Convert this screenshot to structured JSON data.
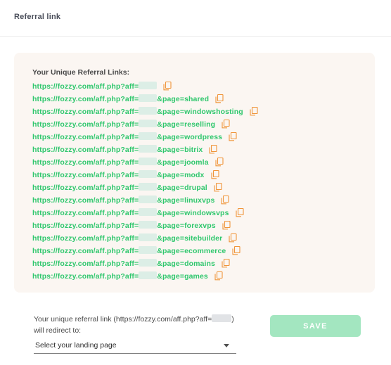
{
  "header": {
    "title": "Referral link"
  },
  "links_section": {
    "heading": "Your Unique Referral Links:",
    "prefix": "https://fozzy.com/aff.php?aff=",
    "links": [
      {
        "suffix": ""
      },
      {
        "suffix": "&page=shared"
      },
      {
        "suffix": "&page=windowshosting"
      },
      {
        "suffix": "&page=reselling"
      },
      {
        "suffix": "&page=wordpress"
      },
      {
        "suffix": "&page=bitrix"
      },
      {
        "suffix": "&page=joomla"
      },
      {
        "suffix": "&page=modx"
      },
      {
        "suffix": "&page=drupal"
      },
      {
        "suffix": "&page=linuxvps"
      },
      {
        "suffix": "&page=windowsvps"
      },
      {
        "suffix": "&page=forexvps"
      },
      {
        "suffix": "&page=sitebuilder"
      },
      {
        "suffix": "&page=ecommerce"
      },
      {
        "suffix": "&page=domains"
      },
      {
        "suffix": "&page=games"
      }
    ],
    "copy_icon": "copy-icon",
    "link_color": "#2fc76d",
    "icon_color": "#f0953a"
  },
  "redirect": {
    "text_before": "Your unique referral link (https://fozzy.com/aff.php?aff=",
    "text_after": ") will redirect to:",
    "select_value": "Select your landing page"
  },
  "save_button": {
    "label": "SAVE",
    "color": "#a3e6c0"
  }
}
